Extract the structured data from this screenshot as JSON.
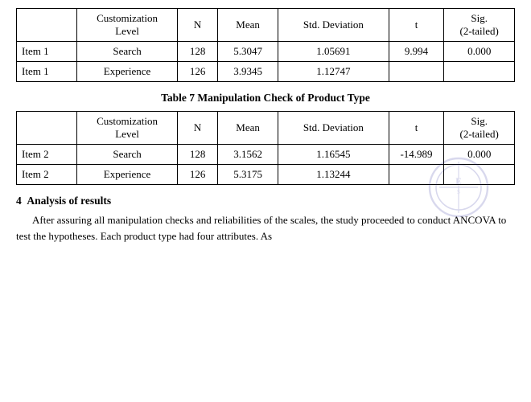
{
  "table1": {
    "headers": [
      "",
      "Customization Level",
      "N",
      "Mean",
      "Std. Deviation",
      "t",
      "Sig. (2-tailed)"
    ],
    "rows": [
      [
        "Item 1",
        "Search",
        "128",
        "5.3047",
        "1.05691",
        "9.994",
        "0.000"
      ],
      [
        "Item 1",
        "Experience",
        "126",
        "3.9345",
        "1.12747",
        "",
        ""
      ]
    ]
  },
  "table2_title": "Table 7 Manipulation Check of Product Type",
  "table2": {
    "headers": [
      "",
      "Customization Level",
      "N",
      "Mean",
      "Std. Deviation",
      "t",
      "Sig. (2-tailed)"
    ],
    "rows": [
      [
        "Item 2",
        "Search",
        "128",
        "3.1562",
        "1.16545",
        "-14.989",
        "0.000"
      ],
      [
        "Item 2",
        "Experience",
        "126",
        "5.3175",
        "1.13244",
        "",
        ""
      ]
    ]
  },
  "analysis": {
    "section_number": "4",
    "heading": "Analysis of results",
    "paragraph": "After assuring all manipulation checks and reliabilities of the scales, the study proceeded to conduct ANCOVA to test the hypotheses. Each product type had four attributes. As"
  }
}
